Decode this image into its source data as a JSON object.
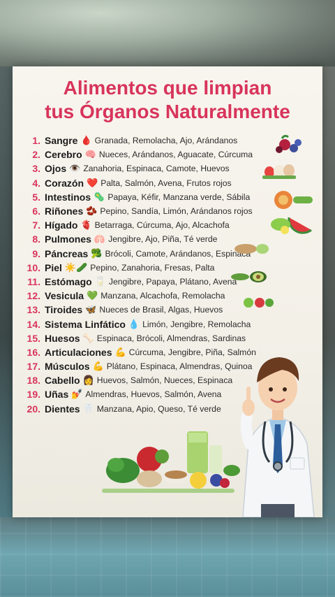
{
  "title": {
    "line1": "Alimentos que limpian",
    "line2": "tus Órganos Naturalmente"
  },
  "items": [
    {
      "num": "1.",
      "organ": "Sangre",
      "emoji": "🩸",
      "foods": "Granada, Remolacha, Ajo, Arándanos"
    },
    {
      "num": "2.",
      "organ": "Cerebro",
      "emoji": "🧠",
      "foods": "Nueces, Arándanos, Aguacate, Cúrcuma"
    },
    {
      "num": "3.",
      "organ": "Ojos",
      "emoji": "👁️",
      "foods": "Zanahoria, Espinaca, Camote, Huevos"
    },
    {
      "num": "4.",
      "organ": "Corazón",
      "emoji": "❤️",
      "foods": "Palta, Salmón, Avena, Frutos rojos"
    },
    {
      "num": "5.",
      "organ": "Intestinos",
      "emoji": "🦠",
      "foods": "Papaya, Kéfir, Manzana verde, Sábila"
    },
    {
      "num": "6.",
      "organ": "Riñones",
      "emoji": "🫘",
      "foods": "Pepino, Sandía, Limón, Arándanos rojos"
    },
    {
      "num": "7.",
      "organ": "Hígado",
      "emoji": "🫀",
      "foods": "Betarraga, Cúrcuma, Ajo, Alcachofa"
    },
    {
      "num": "8.",
      "organ": "Pulmones",
      "emoji": "🫁",
      "foods": "Jengibre, Ajo, Piña, Té verde"
    },
    {
      "num": "9.",
      "organ": "Páncreas",
      "emoji": "🥦",
      "foods": "Brócoli, Camote, Arándanos, Espinaca"
    },
    {
      "num": "10.",
      "organ": "Piel",
      "emoji": "☀️🥒",
      "foods": "Pepino, Zanahoria, Fresas, Palta"
    },
    {
      "num": "11.",
      "organ": "Estómago",
      "emoji": "🥛",
      "foods": "Jengibre, Papaya, Plátano, Avena"
    },
    {
      "num": "12.",
      "organ": "Vesicula",
      "emoji": "💚",
      "foods": "Manzana, Alcachofa, Remolacha"
    },
    {
      "num": "13.",
      "organ": "Tiroides",
      "emoji": "🦋",
      "foods": "Nueces de Brasil, Algas, Huevos"
    },
    {
      "num": "14.",
      "organ": "Sistema Linfático",
      "emoji": "💧",
      "foods": "Limón, Jengibre, Remolacha"
    },
    {
      "num": "15.",
      "organ": "Huesos",
      "emoji": "🦴",
      "foods": "Espinaca, Brócoli, Almendras, Sardinas"
    },
    {
      "num": "16.",
      "organ": "Articulaciones",
      "emoji": "💪",
      "foods": "Cúrcuma, Jengibre, Piña, Salmón"
    },
    {
      "num": "17.",
      "organ": "Músculos",
      "emoji": "💪",
      "foods": "Plátano, Espinaca, Almendras, Quinoa"
    },
    {
      "num": "18.",
      "organ": "Cabello",
      "emoji": "👩",
      "foods": "Huevos, Salmón, Nueces, Espinaca"
    },
    {
      "num": "19.",
      "organ": "Uñas",
      "emoji": "💅",
      "foods": "Almendras, Huevos, Salmón, Avena"
    },
    {
      "num": "20.",
      "organ": "Dientes",
      "emoji": "🦷",
      "foods": "Manzana, Apio, Queso, Té verde"
    }
  ],
  "colors": {
    "accent": "#d8345b",
    "card_bg": "#f6f3ec",
    "text": "#1f1f1f"
  },
  "icons": {
    "doctor": "doctor-illustration",
    "food_pile": "food-pile-illustration"
  }
}
